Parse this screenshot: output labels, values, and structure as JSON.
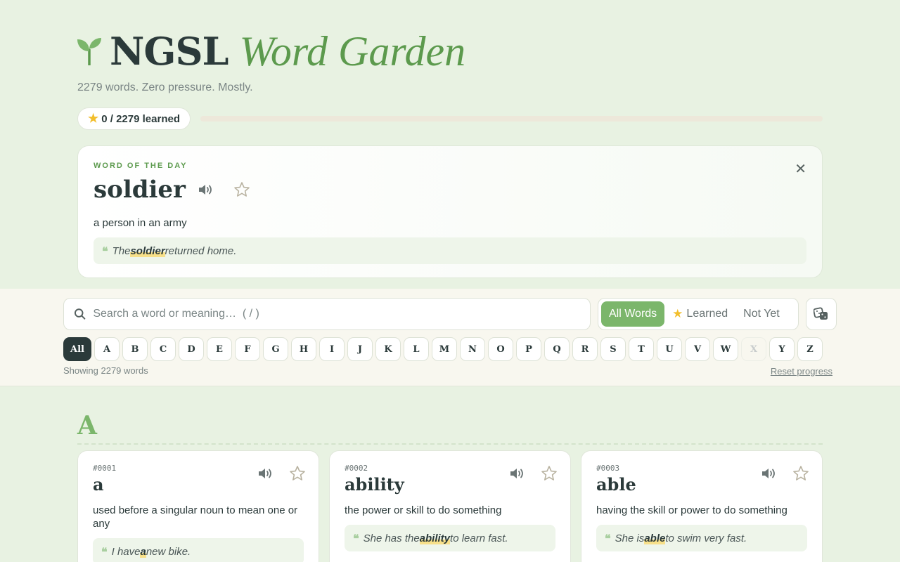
{
  "header": {
    "title_main": "NGSL",
    "title_accent": "Word Garden",
    "tagline": "2279 words. Zero pressure. Mostly.",
    "learned_label": "0 / 2279 learned",
    "progress_fraction": 0
  },
  "word_of_day": {
    "label": "WORD OF THE DAY",
    "word": "soldier",
    "definition": "a person in an army",
    "example_before": "The ",
    "example_word": "soldier",
    "example_after": " returned home."
  },
  "search": {
    "placeholder": "Search a word or meaning…  ( / )"
  },
  "filters": {
    "all": "All Words",
    "learned": "Learned",
    "not_yet": "Not Yet"
  },
  "letters": [
    "All",
    "A",
    "B",
    "C",
    "D",
    "E",
    "F",
    "G",
    "H",
    "I",
    "J",
    "K",
    "L",
    "M",
    "N",
    "O",
    "P",
    "Q",
    "R",
    "S",
    "T",
    "U",
    "V",
    "W",
    "X",
    "Y",
    "Z"
  ],
  "status": {
    "showing": "Showing 2279 words",
    "reset": "Reset progress"
  },
  "section": {
    "letter": "A"
  },
  "cards": [
    {
      "num": "#0001",
      "word": "a",
      "definition": "used before a singular noun to mean one or any",
      "example_before": "I have ",
      "example_word": "a",
      "example_after": " new bike."
    },
    {
      "num": "#0002",
      "word": "ability",
      "definition": "the power or skill to do something",
      "example_before": "She has the ",
      "example_word": "ability",
      "example_after": " to learn fast."
    },
    {
      "num": "#0003",
      "word": "able",
      "definition": "having the skill or power to do something",
      "example_before": "She is ",
      "example_word": "able",
      "example_after": " to swim very fast."
    }
  ],
  "colors": {
    "background": "#e8f2e2",
    "accent_green": "#5c9a4d",
    "active_green": "#7bb66b",
    "star_gold": "#f2be2c",
    "ink": "#2b3a3a"
  },
  "icons": [
    "sprout-icon",
    "star-icon",
    "speaker-icon",
    "star-outline-icon",
    "close-icon",
    "search-icon",
    "dice-icon",
    "quote-icon"
  ]
}
